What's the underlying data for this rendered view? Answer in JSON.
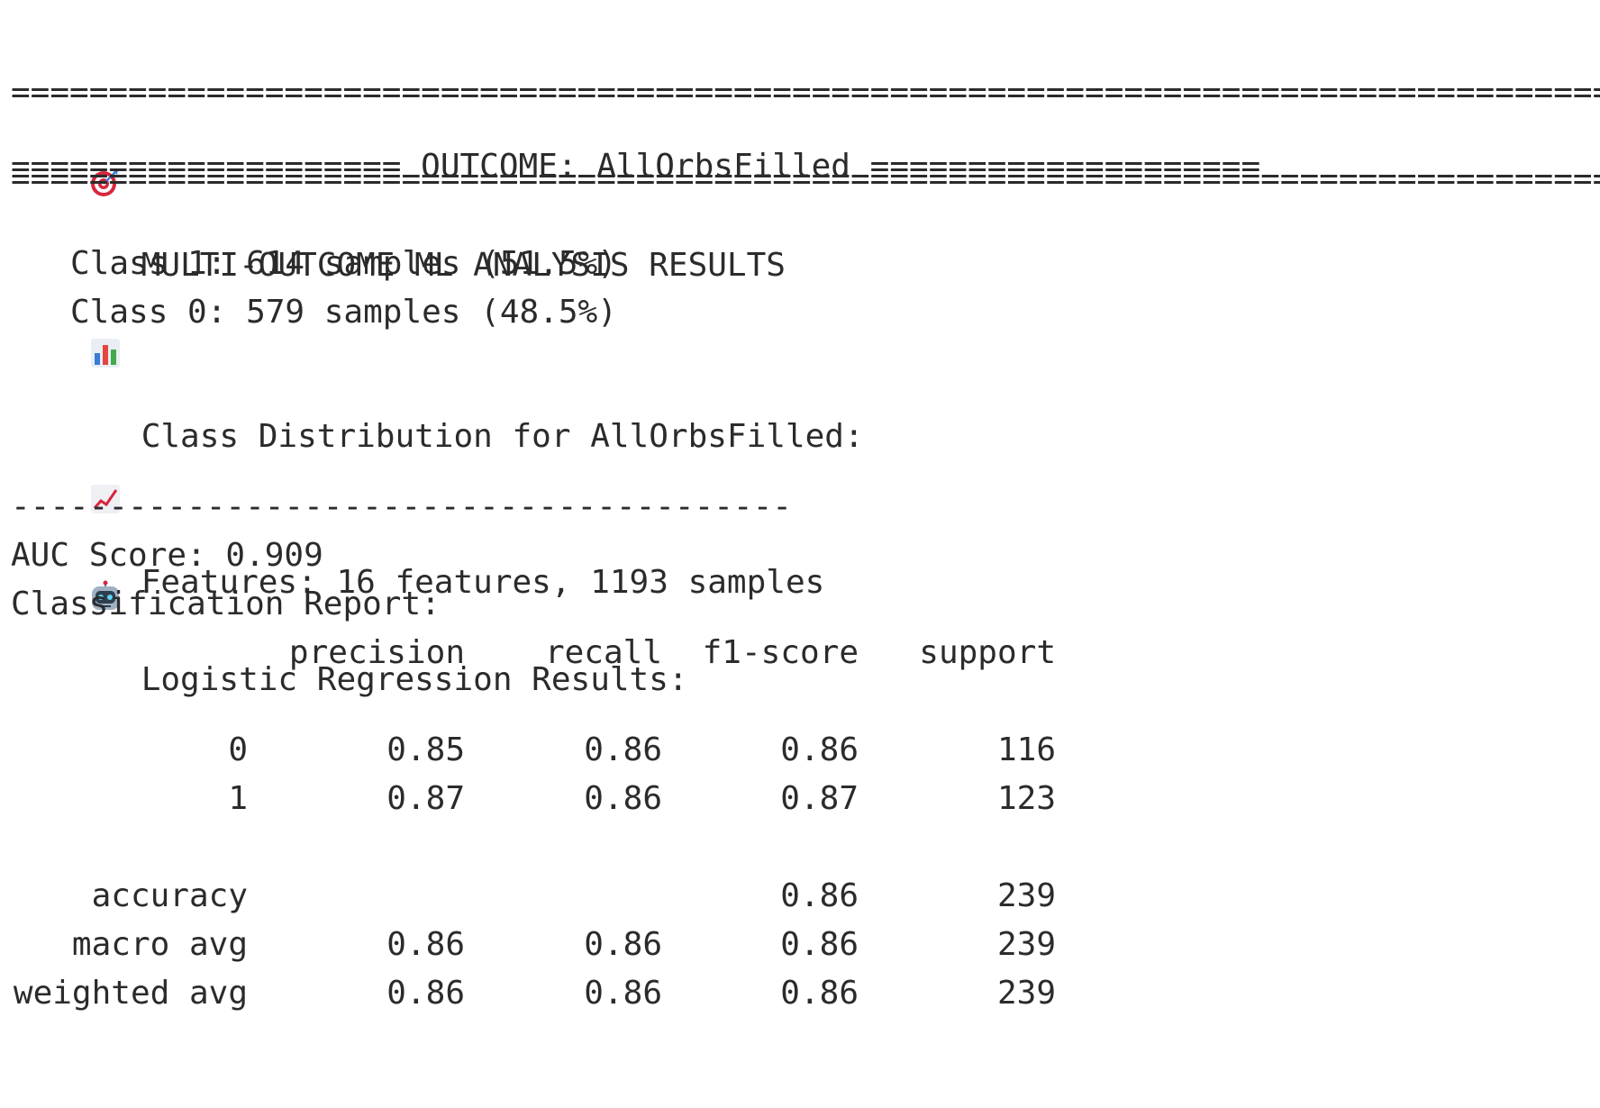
{
  "header": {
    "top_rule": "==========================================================================================",
    "title_icon": "direct-hit-icon",
    "title": "MULTI-OUTCOME ML ANALYSIS RESULTS",
    "bottom_rule": "=========================================================================================="
  },
  "outcome": {
    "banner": "==================== OUTCOME: AllOrbsFilled ===================="
  },
  "class_distribution": {
    "icon": "bar-chart-icon",
    "heading": "Class Distribution for AllOrbsFilled:",
    "lines": [
      "Class 1: 614 samples (51.5%)",
      "Class 0: 579 samples (48.5%)"
    ]
  },
  "features": {
    "icon": "chart-increasing-icon",
    "text": "Features: 16 features, 1193 samples"
  },
  "model": {
    "icon": "robot-icon",
    "heading": "Logistic Regression Results:",
    "rule": "----------------------------------------",
    "auc": "AUC Score: 0.909",
    "report_title": "Classification Report:"
  },
  "report": {
    "columns": [
      "precision",
      "recall",
      "f1-score",
      "support"
    ],
    "rows": [
      {
        "label": "0",
        "precision": "0.85",
        "recall": "0.86",
        "f1": "0.86",
        "support": "116"
      },
      {
        "label": "1",
        "precision": "0.87",
        "recall": "0.86",
        "f1": "0.87",
        "support": "123"
      },
      {
        "label": "accuracy",
        "precision": "",
        "recall": "",
        "f1": "0.86",
        "support": "239"
      },
      {
        "label": "macro avg",
        "precision": "0.86",
        "recall": "0.86",
        "f1": "0.86",
        "support": "239"
      },
      {
        "label": "weighted avg",
        "precision": "0.86",
        "recall": "0.86",
        "f1": "0.86",
        "support": "239"
      }
    ]
  }
}
